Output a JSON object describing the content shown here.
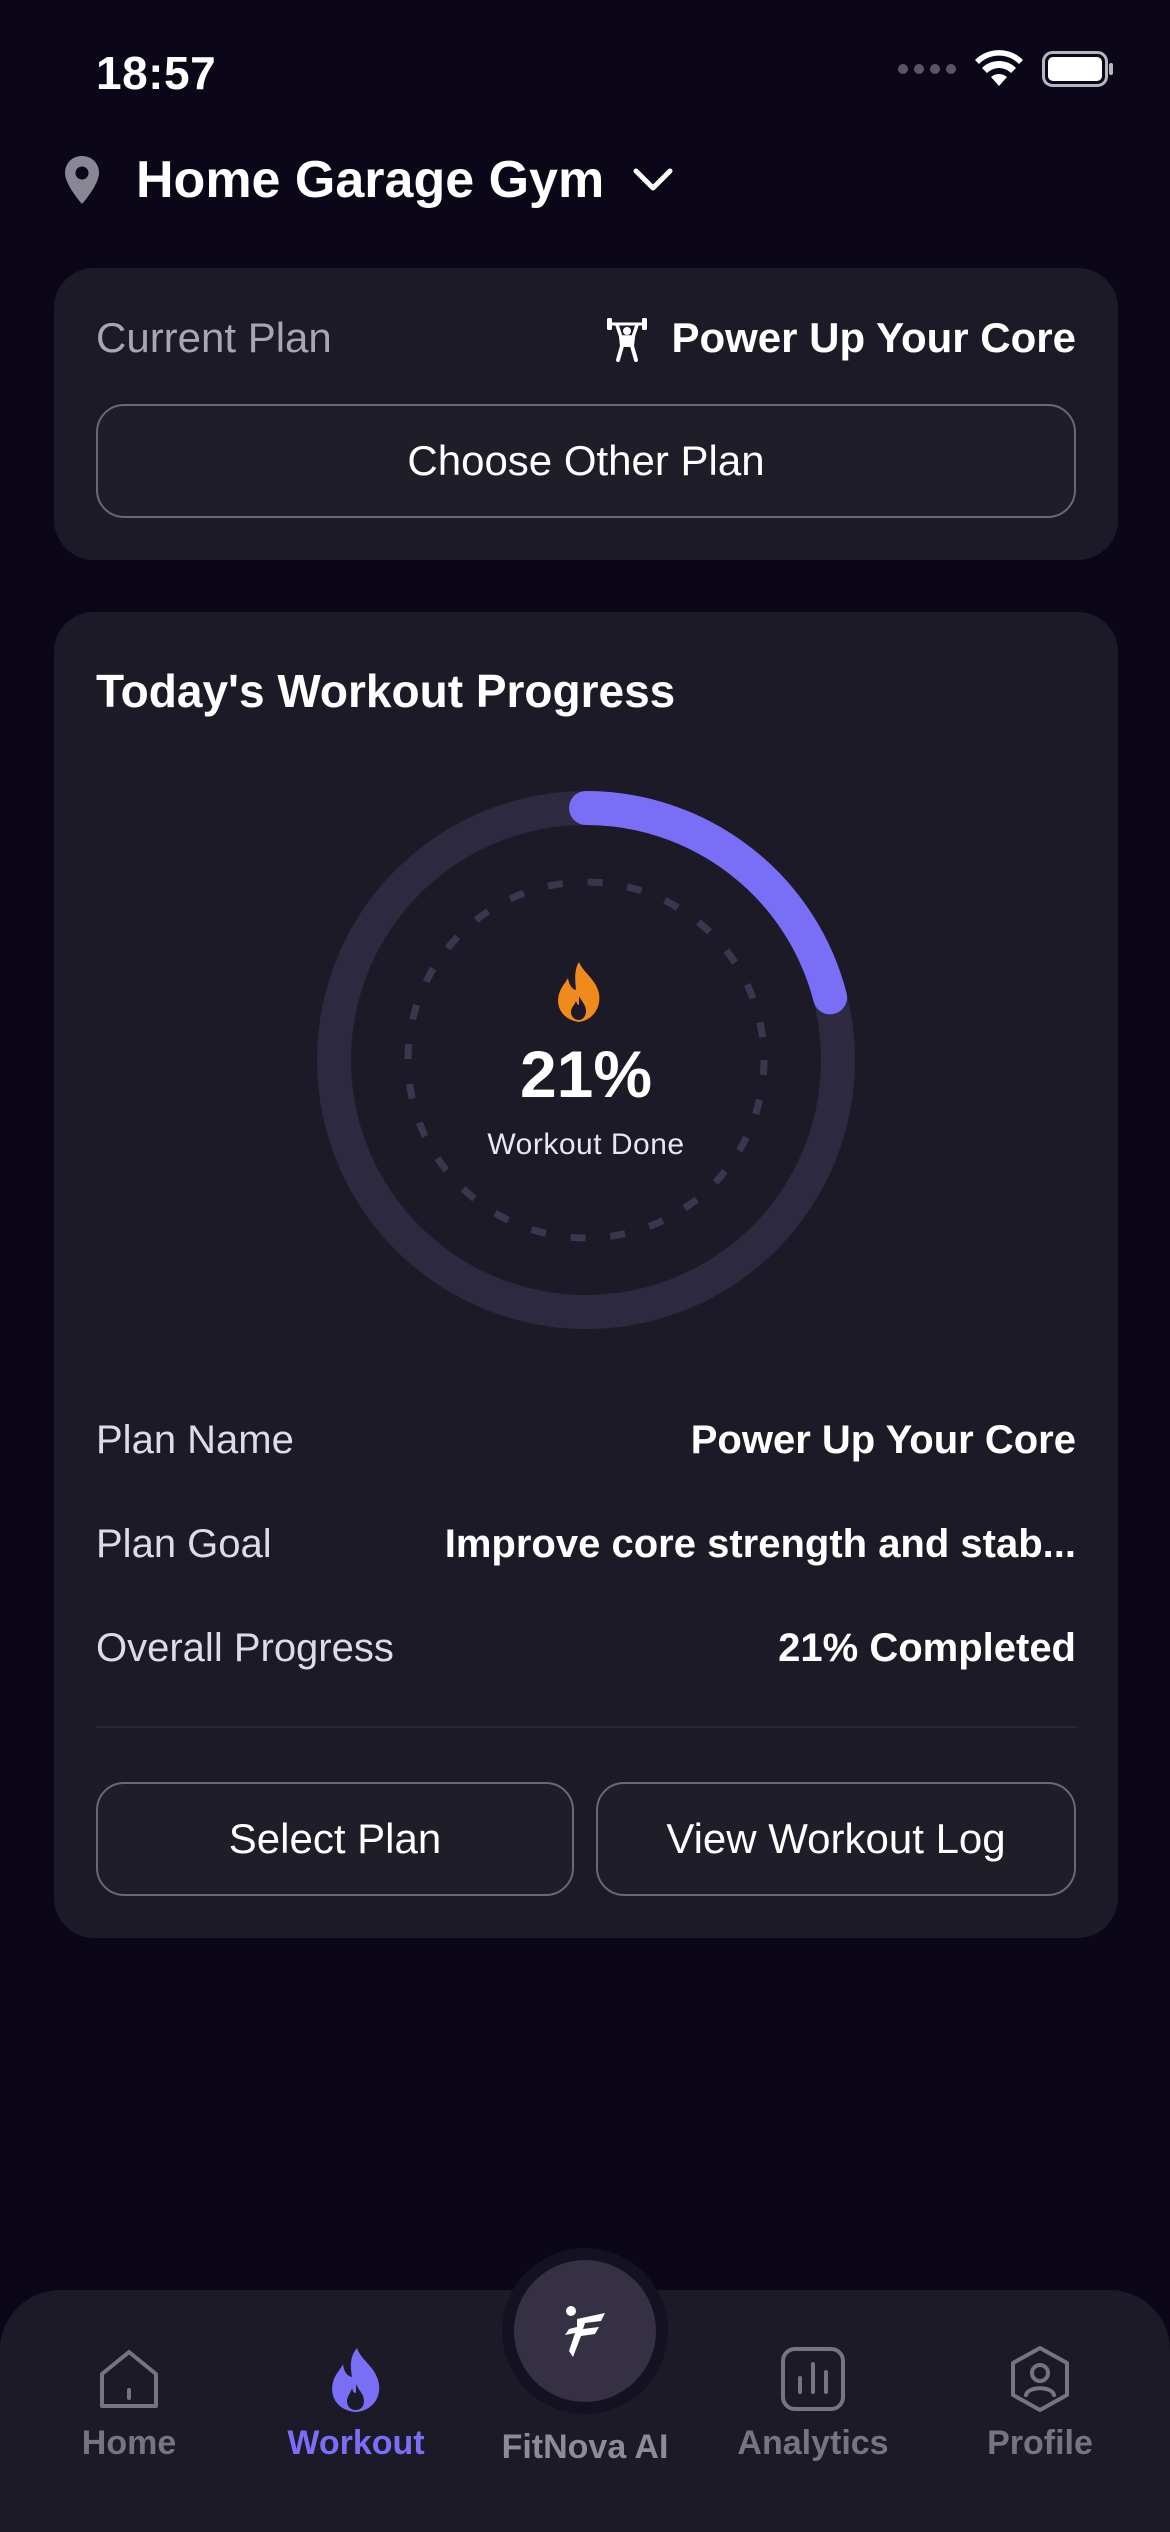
{
  "status_bar": {
    "time": "18:57"
  },
  "header": {
    "gym_name": "Home Garage Gym"
  },
  "current_plan": {
    "label": "Current Plan",
    "plan_name": "Power Up Your Core",
    "choose_button": "Choose Other Plan"
  },
  "progress": {
    "title": "Today's Workout Progress",
    "percent_text": "21%",
    "percent_value": 21,
    "subtitle": "Workout Done",
    "rows": [
      {
        "label": "Plan Name",
        "value": "Power Up Your Core"
      },
      {
        "label": "Plan Goal",
        "value": "Improve core strength and stab..."
      },
      {
        "label": "Overall Progress",
        "value": "21% Completed"
      }
    ],
    "select_button": "Select Plan",
    "log_button": "View Workout Log"
  },
  "tab_bar": {
    "tabs": [
      {
        "label": "Home",
        "icon": "home-icon",
        "active": false
      },
      {
        "label": "Workout",
        "icon": "flame-icon",
        "active": true
      },
      {
        "label": "FitNova AI",
        "icon": "fitnova-logo-icon",
        "active": false
      },
      {
        "label": "Analytics",
        "icon": "analytics-icon",
        "active": false
      },
      {
        "label": "Profile",
        "icon": "profile-icon",
        "active": false
      }
    ]
  },
  "colors": {
    "background": "#0b0618",
    "card": "#1c1a26",
    "accent": "#7b6ef6",
    "flame": "#f08a1c",
    "ring_track": "#2c2940",
    "inactive": "#77737f"
  }
}
